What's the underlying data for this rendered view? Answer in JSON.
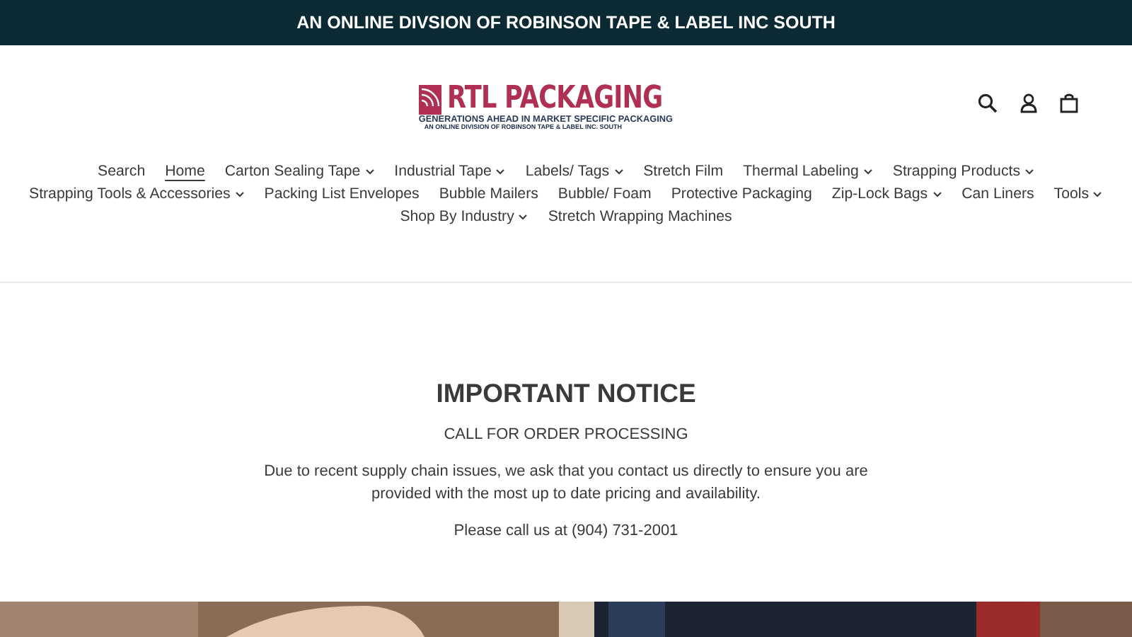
{
  "announcement": "AN ONLINE DIVSION OF ROBINSON TAPE & LABEL INC SOUTH",
  "logo": {
    "name": "RTL PACKAGING",
    "tagline": "GENERATIONS AHEAD IN MARKET SPECIFIC PACKAGING",
    "subline": "AN ONLINE DIVISION OF ROBINSON TAPE & LABEL INC. SOUTH"
  },
  "nav": [
    {
      "label": "Search",
      "dropdown": false,
      "selected": false
    },
    {
      "label": "Home",
      "dropdown": false,
      "selected": true
    },
    {
      "label": "Carton Sealing Tape",
      "dropdown": true,
      "selected": false
    },
    {
      "label": "Industrial Tape",
      "dropdown": true,
      "selected": false
    },
    {
      "label": "Labels/ Tags",
      "dropdown": true,
      "selected": false
    },
    {
      "label": "Stretch Film",
      "dropdown": false,
      "selected": false
    },
    {
      "label": "Thermal Labeling",
      "dropdown": true,
      "selected": false
    },
    {
      "label": "Strapping Products",
      "dropdown": true,
      "selected": false
    },
    {
      "label": "Strapping Tools & Accessories",
      "dropdown": true,
      "selected": false
    },
    {
      "label": "Packing List Envelopes",
      "dropdown": false,
      "selected": false
    },
    {
      "label": "Bubble Mailers",
      "dropdown": false,
      "selected": false
    },
    {
      "label": "Bubble/ Foam",
      "dropdown": false,
      "selected": false
    },
    {
      "label": "Protective Packaging",
      "dropdown": false,
      "selected": false
    },
    {
      "label": "Zip-Lock Bags",
      "dropdown": true,
      "selected": false
    },
    {
      "label": "Can Liners",
      "dropdown": false,
      "selected": false
    },
    {
      "label": "Tools",
      "dropdown": true,
      "selected": false
    },
    {
      "label": "Shop By Industry",
      "dropdown": true,
      "selected": false
    },
    {
      "label": "Stretch Wrapping Machines",
      "dropdown": false,
      "selected": false
    }
  ],
  "notice": {
    "title": "IMPORTANT NOTICE",
    "subtitle": "CALL FOR ORDER PROCESSING",
    "body": "Due to recent supply chain issues, we ask that you contact us directly to ensure you are provided with the most up to date pricing and availability.",
    "call": "Please call us at (904) 731-2001"
  }
}
